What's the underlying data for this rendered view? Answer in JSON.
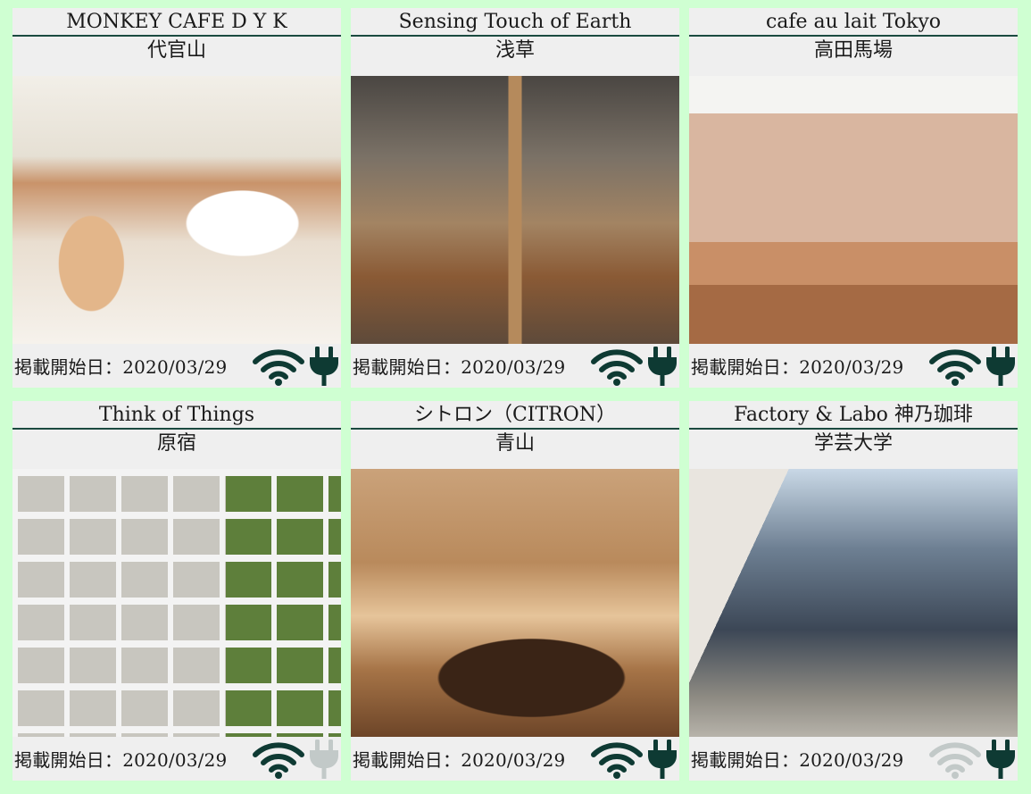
{
  "colors": {
    "page_background": "#cfffd2",
    "card_background": "#efefef",
    "accent": "#1b4a40",
    "icon_active": "#0e3a33",
    "icon_inactive": "#c2c9c8"
  },
  "cards": [
    {
      "name": "MONKEY CAFE D Y K",
      "area": "代官山",
      "photo_icon": "cafe-latte-dessert-photo",
      "date": "掲載開始日：2020/03/29",
      "wifi": true,
      "power": true
    },
    {
      "name": "Sensing Touch of Earth",
      "area": "浅草",
      "photo_icon": "cafe-interior-counter-photo",
      "date": "掲載開始日：2020/03/29",
      "wifi": true,
      "power": true
    },
    {
      "name": "cafe au lait Tokyo",
      "area": "高田馬場",
      "photo_icon": "cafe-brick-counter-photo",
      "date": "掲載開始日：2020/03/29",
      "wifi": true,
      "power": true
    },
    {
      "name": "Think of Things",
      "area": "原宿",
      "photo_icon": "building-exterior-photo",
      "date": "掲載開始日：2020/03/29",
      "wifi": true,
      "power": false
    },
    {
      "name": "シトロン（CITRON）",
      "area": "青山",
      "photo_icon": "cafe-dining-room-photo",
      "date": "掲載開始日：2020/03/29",
      "wifi": true,
      "power": true
    },
    {
      "name": "Factory & Labo 神乃珈琲",
      "area": "学芸大学",
      "photo_icon": "cafe-storefront-photo",
      "date": "掲載開始日：2020/03/29",
      "wifi": false,
      "power": true
    }
  ]
}
